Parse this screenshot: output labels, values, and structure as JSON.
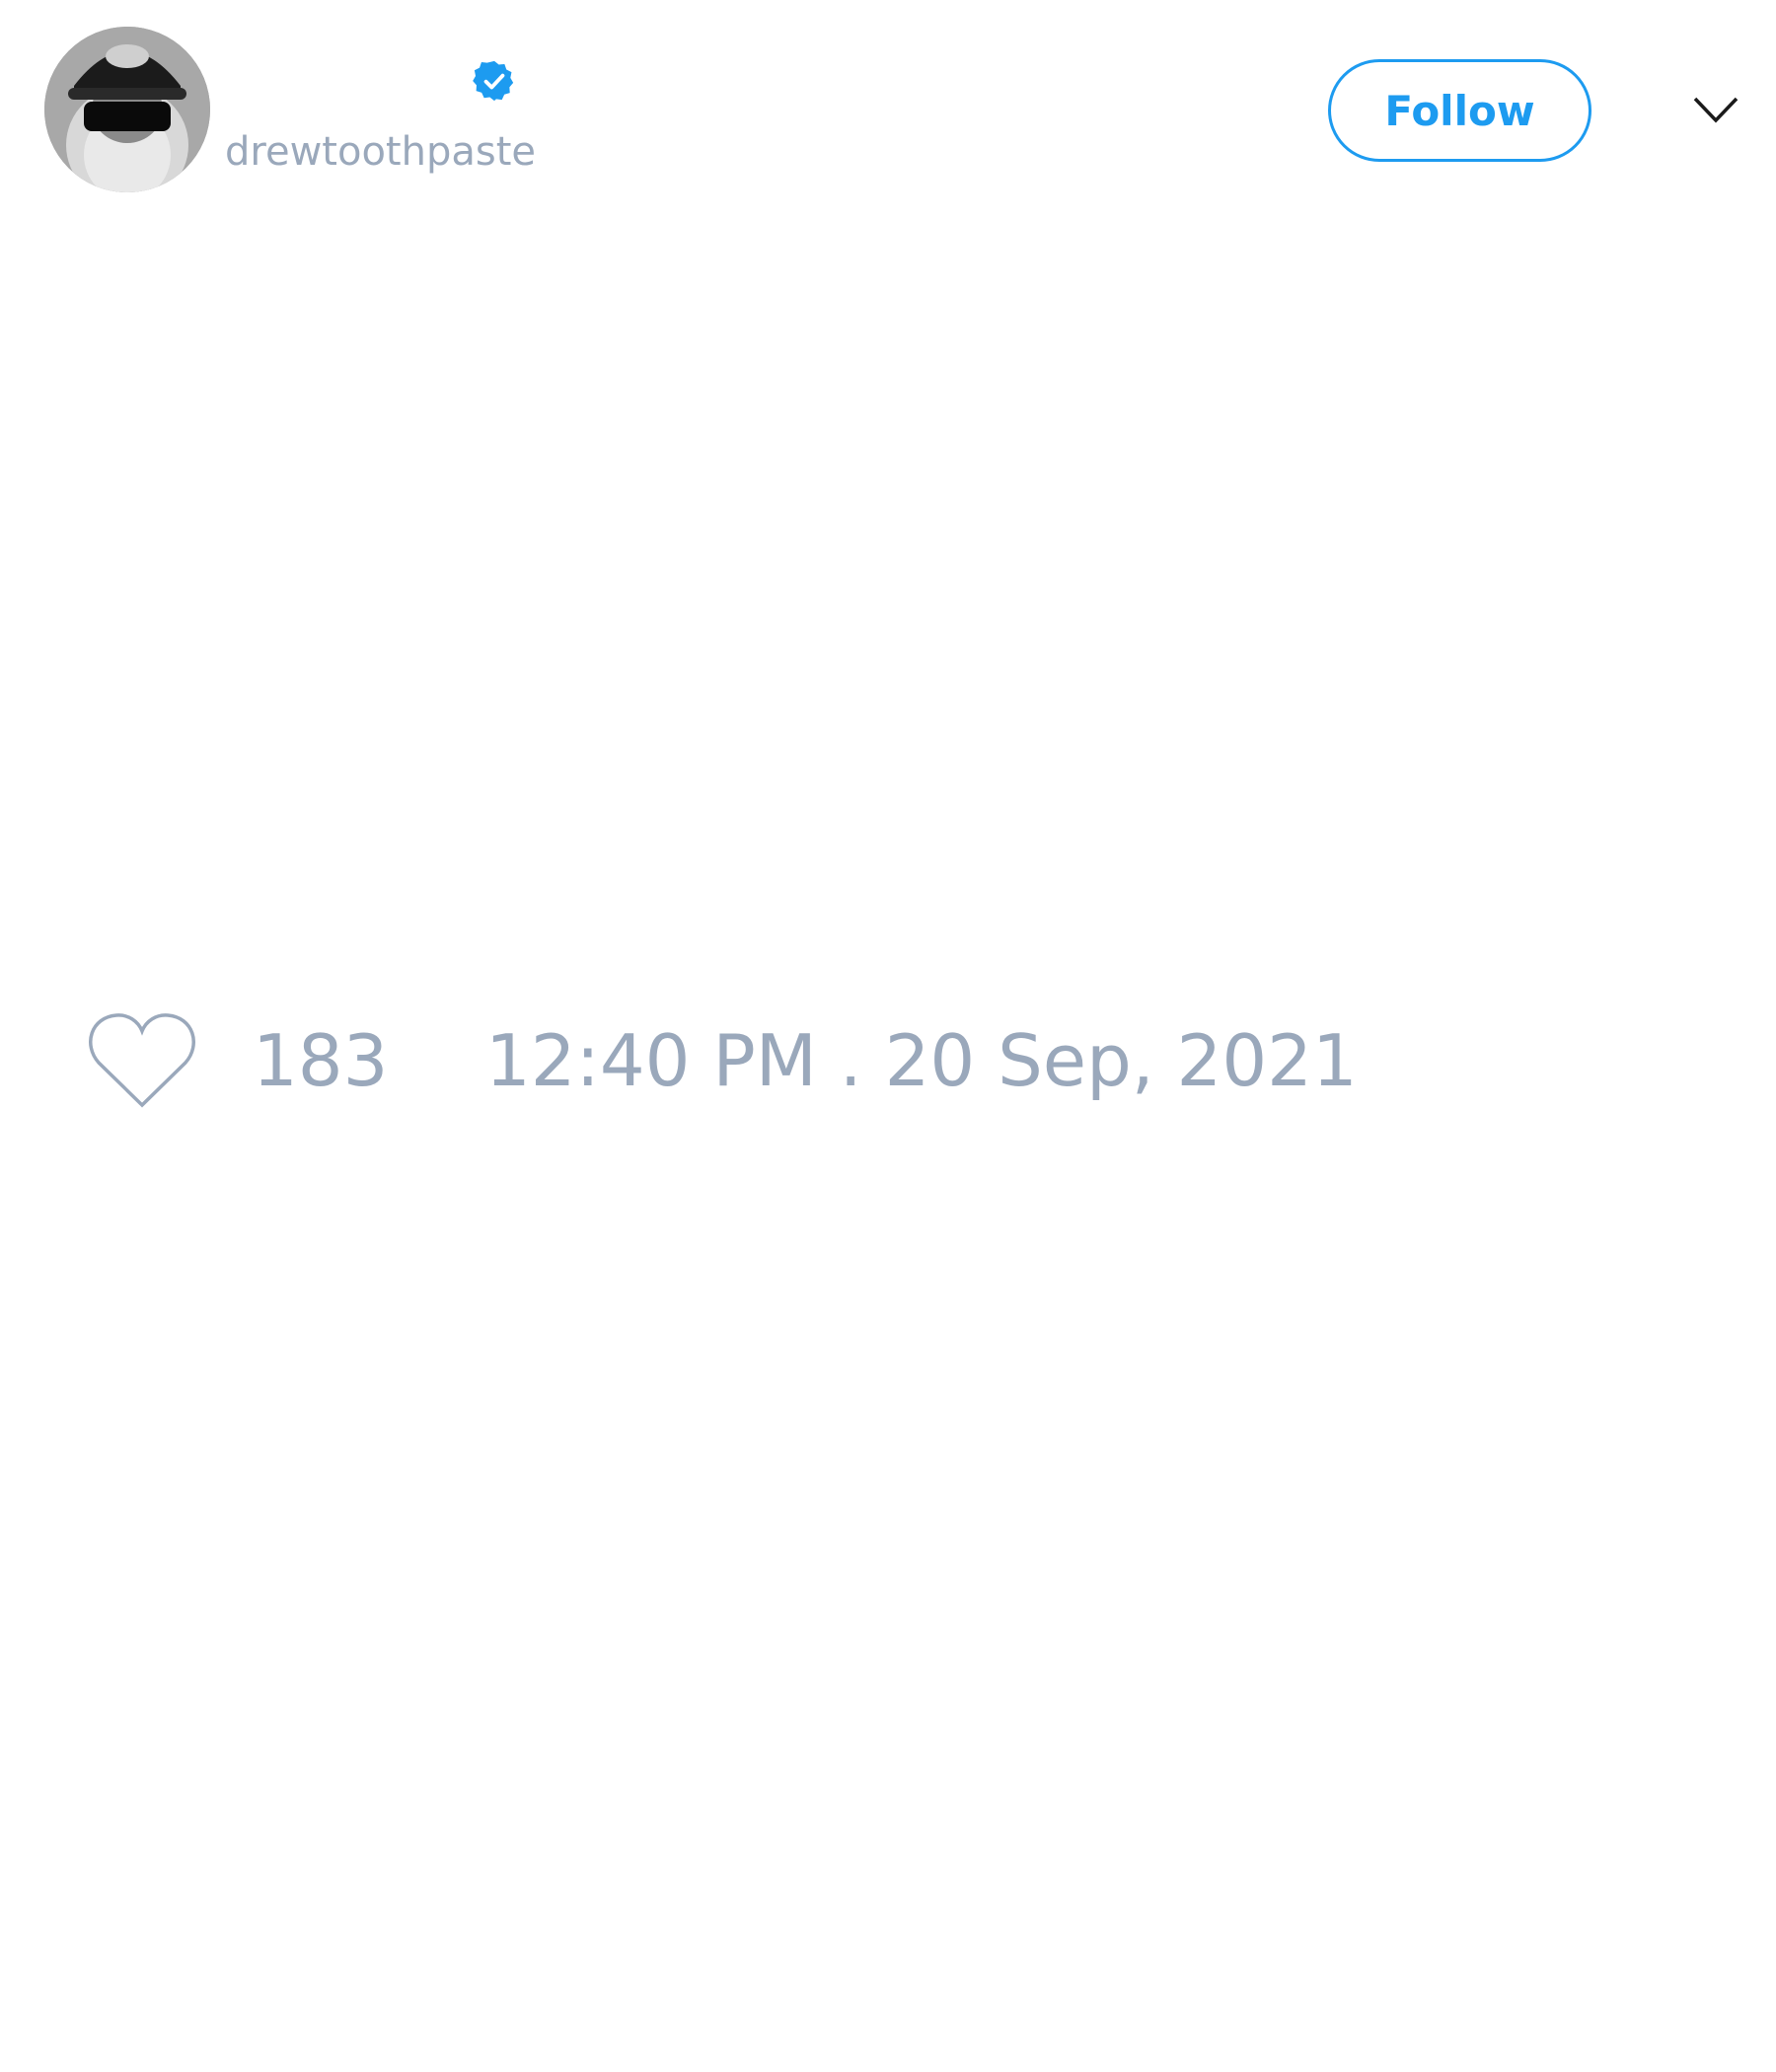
{
  "author": {
    "display_name": "",
    "handle": "drewtoothpaste",
    "verified": true
  },
  "actions": {
    "follow_label": "Follow"
  },
  "tweet": {
    "like_count": "183",
    "timestamp": "12:40 PM . 20 Sep, 2021"
  },
  "icons": {
    "verified": "verified-badge-icon",
    "menu": "chevron-down-icon",
    "like": "heart-outline-icon"
  },
  "colors": {
    "accent": "#1d9bf0",
    "muted_text": "#9aa8bb"
  }
}
